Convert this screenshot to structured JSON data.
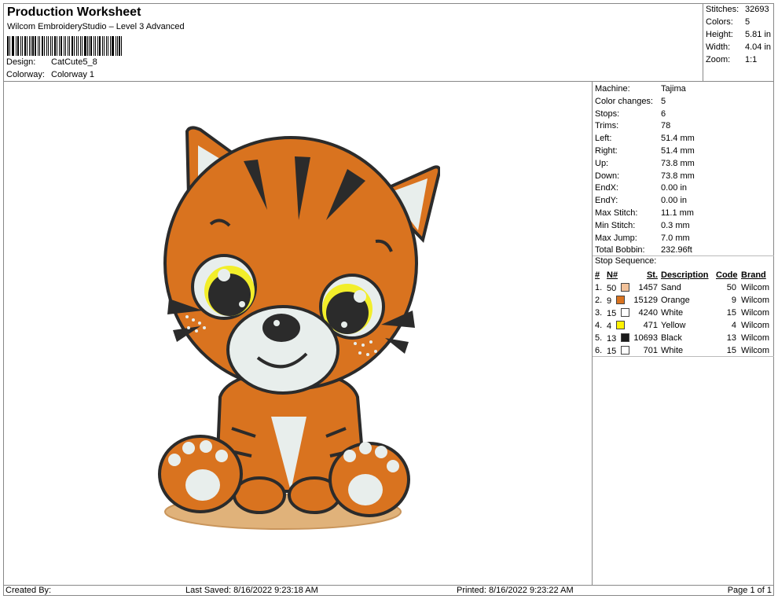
{
  "header": {
    "title": "Production Worksheet",
    "subtitle": "Wilcom EmbroideryStudio – Level 3 Advanced",
    "design_label": "Design:",
    "design_value": "CatCute5_8",
    "colorway_label": "Colorway:",
    "colorway_value": "Colorway 1"
  },
  "stats": [
    {
      "label": "Stitches:",
      "value": "32693"
    },
    {
      "label": "Colors:",
      "value": "5"
    },
    {
      "label": "Height:",
      "value": "5.81 in"
    },
    {
      "label": "Width:",
      "value": "4.04 in"
    },
    {
      "label": "Zoom:",
      "value": "1:1"
    }
  ],
  "machine_info": [
    {
      "label": "Machine:",
      "value": "Tajima"
    },
    {
      "label": "Color changes:",
      "value": "5"
    },
    {
      "label": "Stops:",
      "value": "6"
    },
    {
      "label": "Trims:",
      "value": "78"
    },
    {
      "label": "Left:",
      "value": "51.4 mm"
    },
    {
      "label": "Right:",
      "value": "51.4 mm"
    },
    {
      "label": "Up:",
      "value": "73.8 mm"
    },
    {
      "label": "Down:",
      "value": "73.8 mm"
    },
    {
      "label": "EndX:",
      "value": "0.00 in"
    },
    {
      "label": "EndY:",
      "value": "0.00 in"
    },
    {
      "label": "Max Stitch:",
      "value": "11.1 mm"
    },
    {
      "label": "Min Stitch:",
      "value": "0.3 mm"
    },
    {
      "label": "Max Jump:",
      "value": "7.0 mm"
    },
    {
      "label": "Total Bobbin:",
      "value": "232.96ft"
    }
  ],
  "stop_sequence": {
    "title": "Stop Sequence:",
    "columns": [
      "#",
      "N#",
      "St.",
      "Description",
      "Code",
      "Brand"
    ],
    "rows": [
      {
        "num": "1.",
        "n": "50",
        "color": "#F2C29A",
        "st": "1457",
        "desc": "Sand",
        "code": "50",
        "brand": "Wilcom"
      },
      {
        "num": "2.",
        "n": "9",
        "color": "#D9731F",
        "st": "15129",
        "desc": "Orange",
        "code": "9",
        "brand": "Wilcom"
      },
      {
        "num": "3.",
        "n": "15",
        "color": "#FFFFFF",
        "st": "4240",
        "desc": "White",
        "code": "15",
        "brand": "Wilcom"
      },
      {
        "num": "4.",
        "n": "4",
        "color": "#FFF200",
        "st": "471",
        "desc": "Yellow",
        "code": "4",
        "brand": "Wilcom"
      },
      {
        "num": "5.",
        "n": "13",
        "color": "#1A1A1A",
        "st": "10693",
        "desc": "Black",
        "code": "13",
        "brand": "Wilcom"
      },
      {
        "num": "6.",
        "n": "15",
        "color": "#FFFFFF",
        "st": "701",
        "desc": "White",
        "code": "15",
        "brand": "Wilcom"
      }
    ]
  },
  "footer": {
    "created_by": "Created By:",
    "last_saved": "Last Saved: 8/16/2022 9:23:18 AM",
    "printed": "Printed: 8/16/2022 9:23:22 AM",
    "page": "Page 1 of 1"
  },
  "colors": {
    "orange": "#D9731F",
    "sand": "#E0B27A",
    "white": "#E8EEEC",
    "yellow": "#F2EE2A",
    "black": "#2B2B2B"
  }
}
